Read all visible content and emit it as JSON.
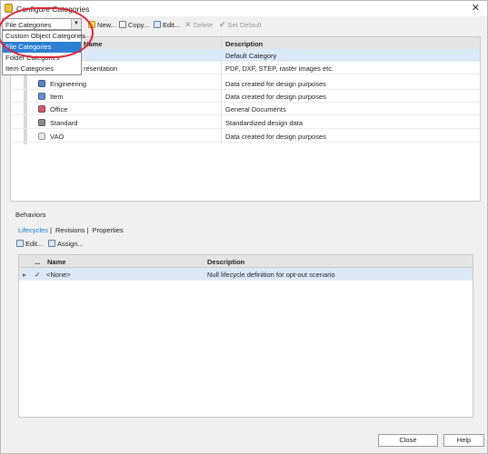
{
  "window": {
    "title": "Configure Categories",
    "close_glyph": "✕"
  },
  "toolbar": {
    "category_select": "File Categories",
    "new_label": "New...",
    "copy_label": "Copy...",
    "edit_label": "Edit...",
    "delete_label": "Delete",
    "set_default_label": "Set Default"
  },
  "dropdown": {
    "options": [
      "Custom Object Categories",
      "File Categories",
      "Folder Categories",
      "Item Categories"
    ],
    "selected_index": 1
  },
  "categories": {
    "columns": [
      "Name",
      "Description"
    ],
    "rows": [
      {
        "name": "",
        "description": "Default Category",
        "color": "",
        "selected": true
      },
      {
        "name": "resentation",
        "description": "PDF, DXF, STEP, raster images etc.",
        "color": ""
      },
      {
        "name": "Engineering",
        "description": "Data created for design purposes",
        "color": "#5b7fc4"
      },
      {
        "name": "Item",
        "description": "Data created for design purposes",
        "color": "#6d8fd0"
      },
      {
        "name": "Office",
        "description": "General Documents",
        "color": "#d05a6e"
      },
      {
        "name": "Standard",
        "description": "Standardized design data",
        "color": "#8c8c8c"
      },
      {
        "name": "VAO",
        "description": "Data created for design purposes",
        "color": "#dfe7f2"
      }
    ]
  },
  "behaviors": {
    "label": "Behaviors",
    "tabs": [
      "Lifecycles",
      "Revisions",
      "Properties"
    ],
    "active_tab": 0,
    "edit_label": "Edit...",
    "assign_label": "Assign...",
    "columns": [
      "...",
      "Name",
      "Description"
    ],
    "rows": [
      {
        "expand": "▸",
        "check": "✓",
        "name": "<None>",
        "description": "Null lifecycle definition for opt-out scenario"
      }
    ]
  },
  "footer": {
    "close_label": "Close",
    "help_label": "Help"
  }
}
